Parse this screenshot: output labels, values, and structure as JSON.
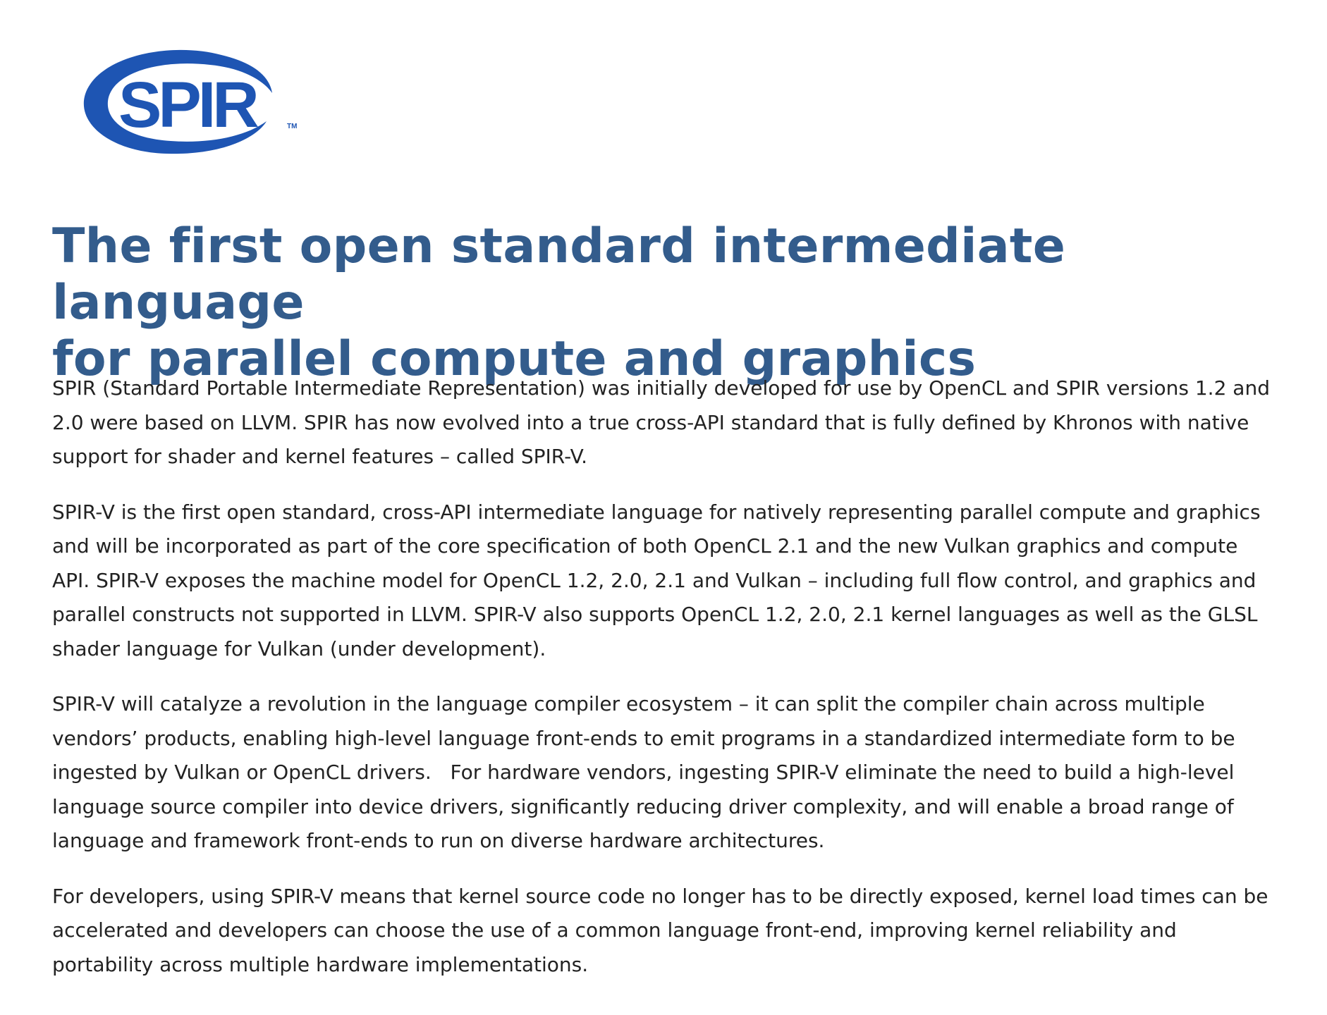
{
  "logo": {
    "text": "SPIR",
    "trademark": "TM",
    "color": "#1e55b3"
  },
  "headline": {
    "line1": "The first open standard intermediate language",
    "line2": "for parallel compute and graphics",
    "color": "#335c8c"
  },
  "paragraphs": [
    "SPIR (Standard Portable Intermediate Representation) was initially developed for use by OpenCL and SPIR versions 1.2 and 2.0 were based on LLVM. SPIR has now evolved into a true cross-API standard that is fully defined by Khronos with native support for shader and kernel features – called SPIR-V.",
    "SPIR-V is the first open standard, cross-API intermediate language for natively representing parallel compute and graphics and will be incorporated as part of the core specification of both OpenCL 2.1 and the new Vulkan graphics and compute API. SPIR-V exposes the machine model for OpenCL 1.2, 2.0, 2.1 and Vulkan – including full flow control, and graphics and parallel constructs not supported in LLVM. SPIR-V also supports OpenCL 1.2, 2.0, 2.1 kernel languages as well as the GLSL shader language for Vulkan (under development).",
    "SPIR-V will catalyze a revolution in the language compiler ecosystem – it can split the compiler chain across multiple vendors’ products, enabling high-level language front-ends to emit programs in a standardized intermediate form to be ingested by Vulkan or OpenCL drivers.   For hardware vendors, ingesting SPIR-V eliminate the need to build a high-level language source compiler into device drivers, significantly reducing driver complexity, and will enable a broad range of language and framework front-ends to run on diverse hardware architectures.",
    "For developers, using SPIR-V means that kernel source code no longer has to be directly exposed, kernel load times can be accelerated and developers can choose the use of a common language front-end, improving kernel reliability and portability across multiple hardware implementations."
  ]
}
